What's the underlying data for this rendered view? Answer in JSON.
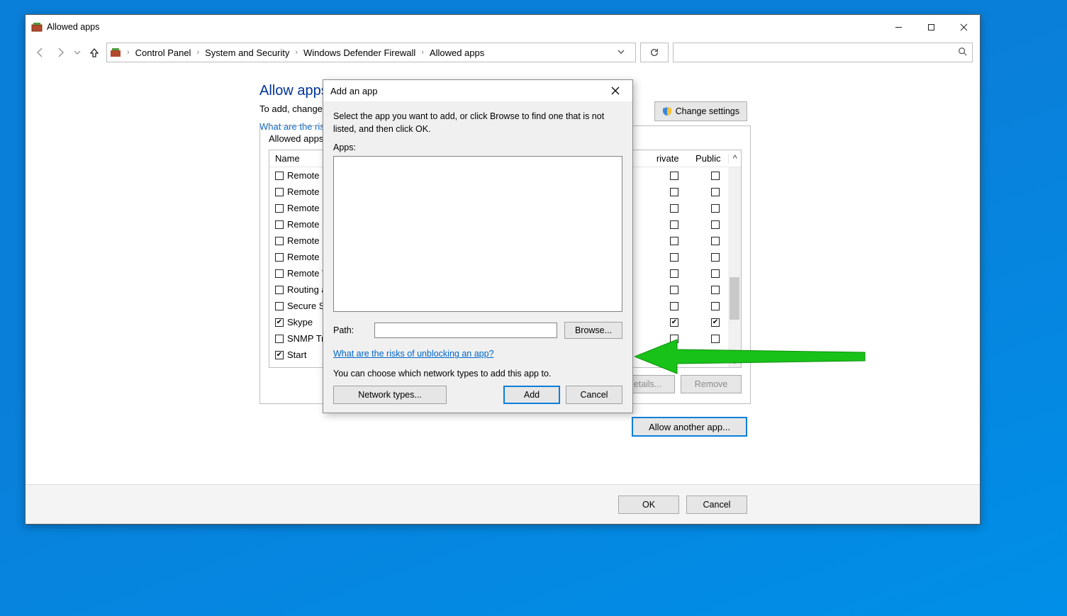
{
  "window": {
    "title": "Allowed apps",
    "breadcrumbs": [
      "Control Panel",
      "System and Security",
      "Windows Defender Firewall",
      "Allowed apps"
    ]
  },
  "page": {
    "title_partial": "Allow apps to c",
    "subtitle_partial": "To add, change, or re",
    "risk_link_partial": "What are the risks of",
    "change_settings": "Change settings",
    "groupbox_title_partial": "Allowed apps and",
    "columns": {
      "name": "Name",
      "private": "rivate",
      "public": "Public"
    },
    "details_btn": "Details...",
    "remove_btn": "Remove",
    "allow_another": "Allow another app...",
    "ok": "OK",
    "cancel": "Cancel",
    "rows": [
      {
        "name": "Remote Deskto",
        "name_chk": false,
        "priv": false,
        "pub": false
      },
      {
        "name": "Remote Event L",
        "name_chk": false,
        "priv": false,
        "pub": false
      },
      {
        "name": "Remote Event M",
        "name_chk": false,
        "priv": false,
        "pub": false
      },
      {
        "name": "Remote Schedu",
        "name_chk": false,
        "priv": false,
        "pub": false
      },
      {
        "name": "Remote Service",
        "name_chk": false,
        "priv": false,
        "pub": false
      },
      {
        "name": "Remote Shutdo",
        "name_chk": false,
        "priv": false,
        "pub": false
      },
      {
        "name": "Remote Volume",
        "name_chk": false,
        "priv": false,
        "pub": false
      },
      {
        "name": "Routing and Re",
        "name_chk": false,
        "priv": false,
        "pub": false
      },
      {
        "name": "Secure Socket T",
        "name_chk": false,
        "priv": false,
        "pub": false
      },
      {
        "name": "Skype",
        "name_chk": true,
        "priv": true,
        "pub": true
      },
      {
        "name": "SNMP Trap",
        "name_chk": false,
        "priv": false,
        "pub": false
      },
      {
        "name": "Start",
        "name_chk": true,
        "priv": true,
        "pub": true
      }
    ]
  },
  "dialog": {
    "title": "Add an app",
    "instruction": "Select the app you want to add, or click Browse to find one that is not listed, and then click OK.",
    "apps_label": "Apps:",
    "path_label": "Path:",
    "path_value": "",
    "browse": "Browse...",
    "risk_link": "What are the risks of unblocking an app?",
    "choose_text": "You can choose which network types to add this app to.",
    "network_types": "Network types...",
    "add": "Add",
    "cancel": "Cancel"
  }
}
